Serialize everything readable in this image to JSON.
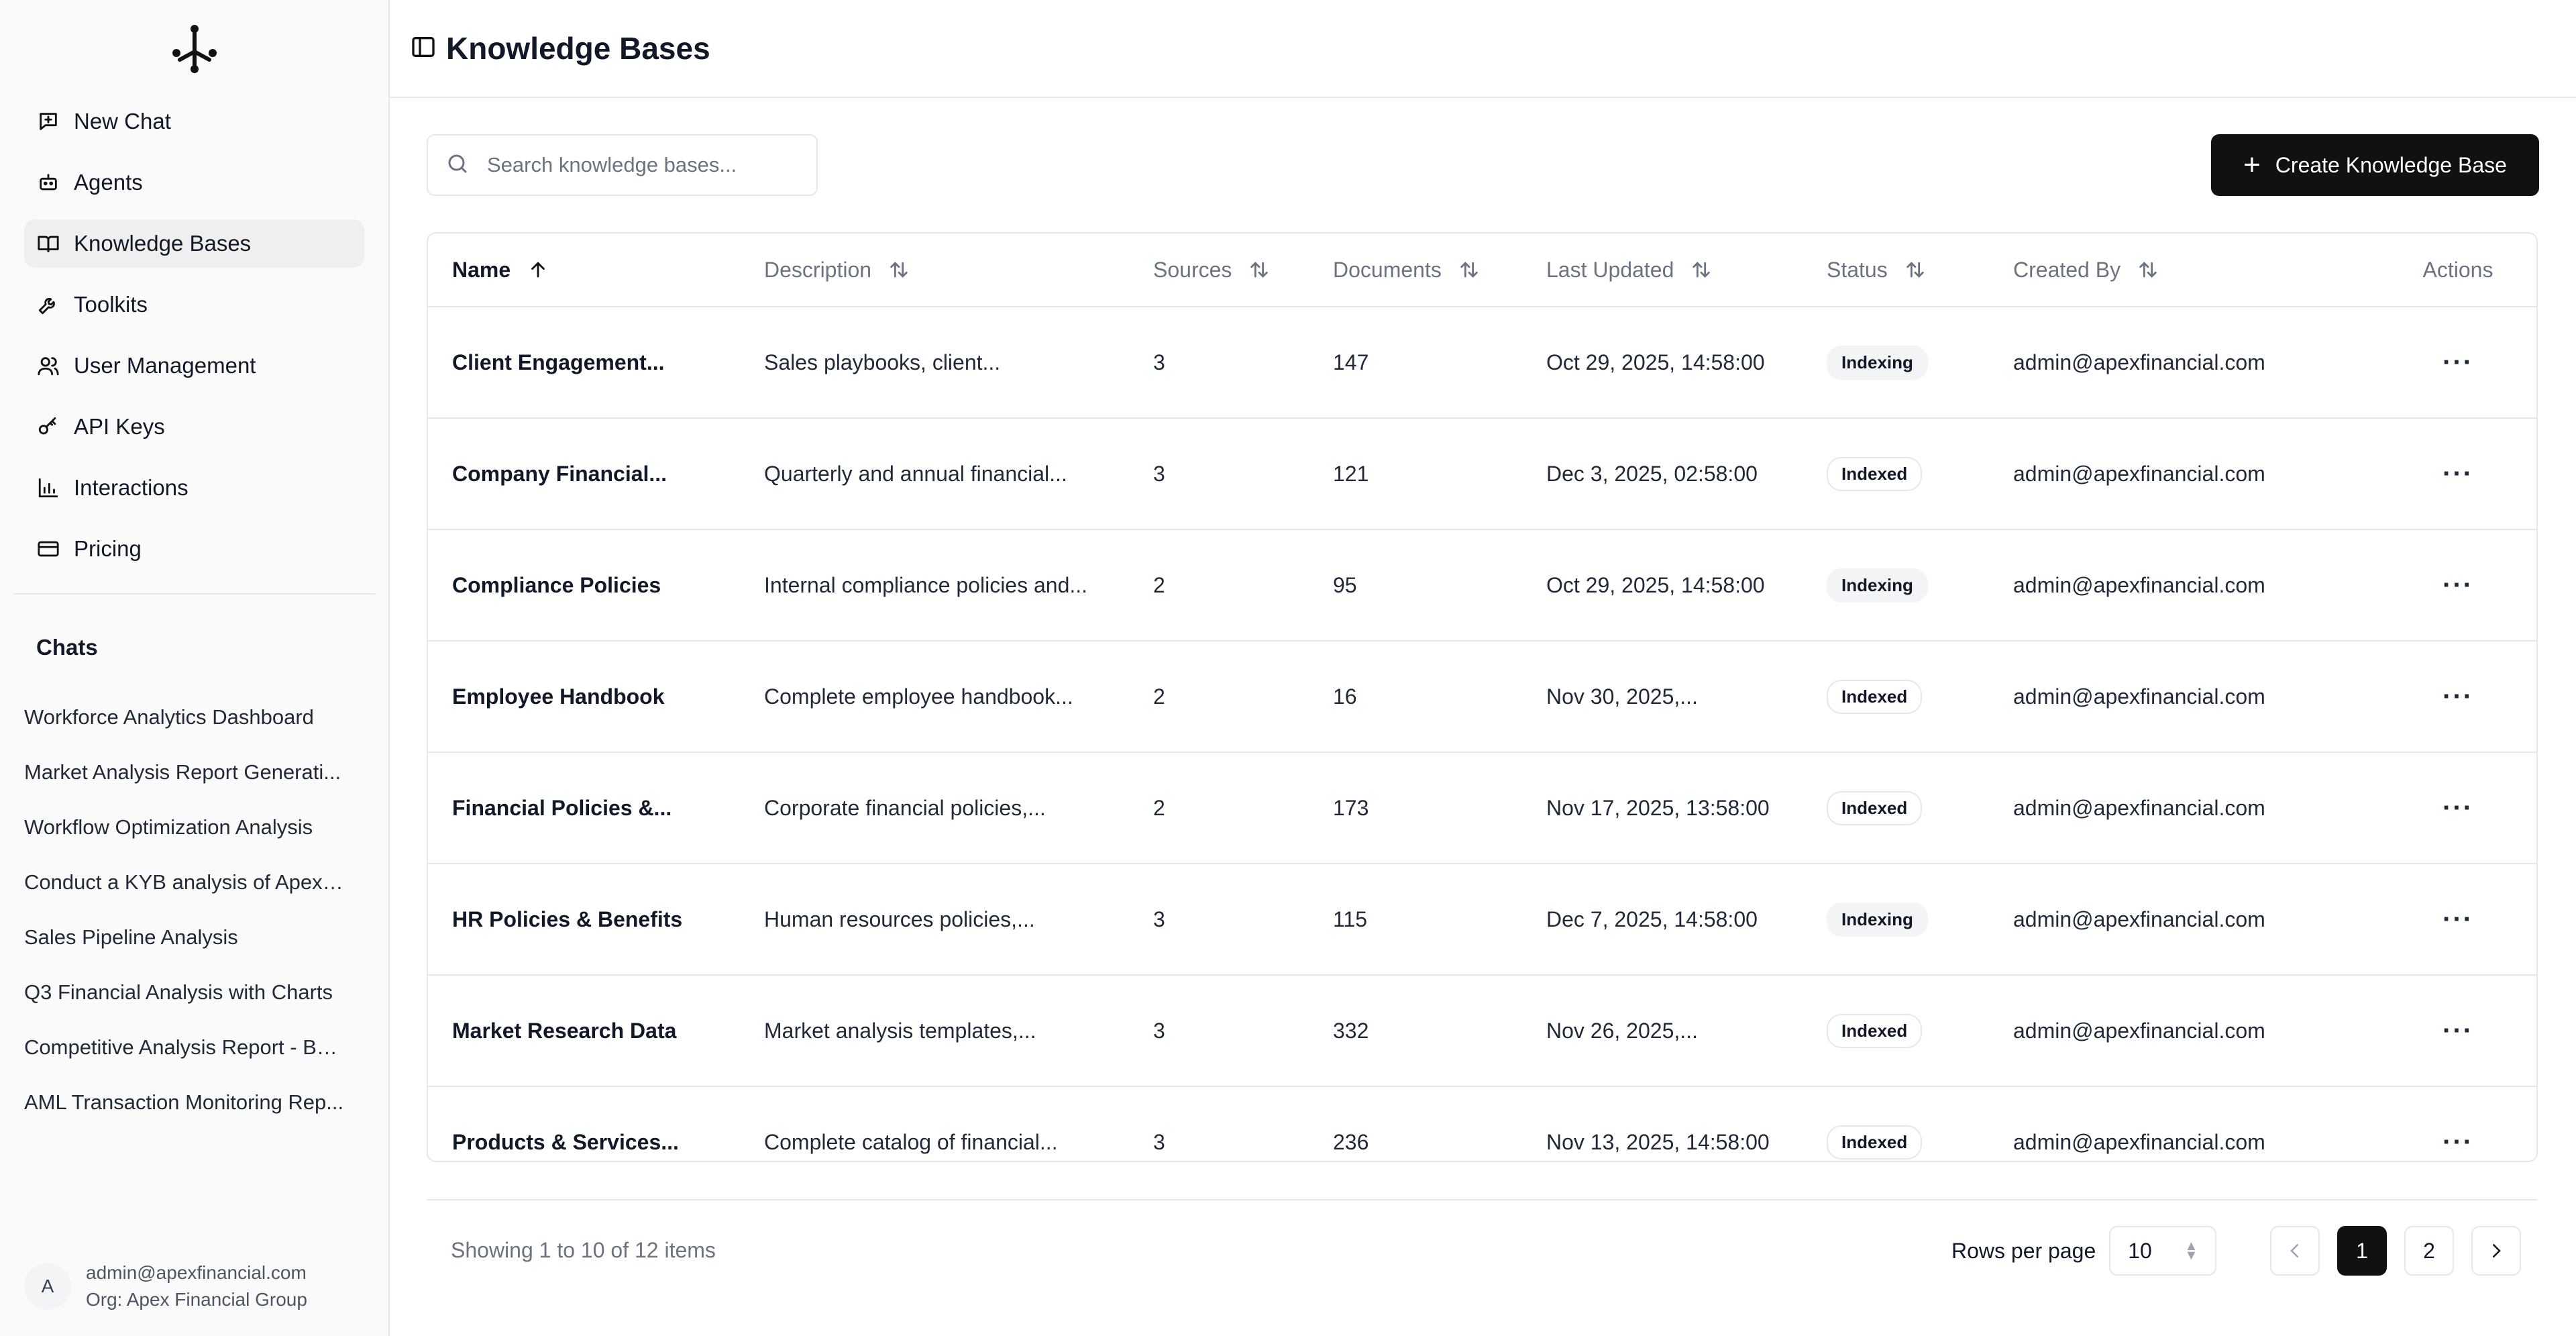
{
  "page": {
    "title": "Knowledge Bases"
  },
  "sidebar": {
    "nav": [
      {
        "label": "New Chat",
        "icon": "new-chat-icon"
      },
      {
        "label": "Agents",
        "icon": "robot-icon"
      },
      {
        "label": "Knowledge Bases",
        "icon": "book-icon",
        "active": true
      },
      {
        "label": "Toolkits",
        "icon": "wrench-icon"
      },
      {
        "label": "User Management",
        "icon": "users-icon"
      },
      {
        "label": "API Keys",
        "icon": "key-icon"
      },
      {
        "label": "Interactions",
        "icon": "bar-chart-icon"
      },
      {
        "label": "Pricing",
        "icon": "credit-card-icon"
      }
    ],
    "chats_title": "Chats",
    "chats": [
      "Workforce Analytics Dashboard",
      "Market Analysis Report Generati...",
      "Workflow Optimization Analysis",
      "Conduct a KYB analysis of Apex ...",
      "Sales Pipeline Analysis",
      "Q3 Financial Analysis with Charts",
      "Competitive Analysis Report - Ba...",
      "AML Transaction Monitoring Rep..."
    ],
    "user": {
      "initial": "A",
      "email": "admin@apexfinancial.com",
      "org": "Org: Apex Financial Group"
    }
  },
  "toolbar": {
    "search_placeholder": "Search knowledge bases...",
    "create_label": "Create Knowledge Base"
  },
  "table": {
    "columns": [
      "Name",
      "Description",
      "Sources",
      "Documents",
      "Last Updated",
      "Status",
      "Created By",
      "Actions"
    ],
    "rows": [
      {
        "name": "Client Engagement...",
        "description": "Sales playbooks, client...",
        "sources": "3",
        "documents": "147",
        "updated": "Oct 29, 2025, 14:58:00",
        "status": "Indexing",
        "created_by": "admin@apexfinancial.com"
      },
      {
        "name": "Company Financial...",
        "description": "Quarterly and annual financial...",
        "sources": "3",
        "documents": "121",
        "updated": "Dec 3, 2025, 02:58:00",
        "status": "Indexed",
        "created_by": "admin@apexfinancial.com"
      },
      {
        "name": "Compliance Policies",
        "description": "Internal compliance policies and...",
        "sources": "2",
        "documents": "95",
        "updated": "Oct 29, 2025, 14:58:00",
        "status": "Indexing",
        "created_by": "admin@apexfinancial.com"
      },
      {
        "name": "Employee Handbook",
        "description": "Complete employee handbook...",
        "sources": "2",
        "documents": "16",
        "updated": "Nov 30, 2025,...",
        "status": "Indexed",
        "created_by": "admin@apexfinancial.com"
      },
      {
        "name": "Financial Policies &...",
        "description": "Corporate financial policies,...",
        "sources": "2",
        "documents": "173",
        "updated": "Nov 17, 2025, 13:58:00",
        "status": "Indexed",
        "created_by": "admin@apexfinancial.com"
      },
      {
        "name": "HR Policies & Benefits",
        "description": "Human resources policies,...",
        "sources": "3",
        "documents": "115",
        "updated": "Dec 7, 2025, 14:58:00",
        "status": "Indexing",
        "created_by": "admin@apexfinancial.com"
      },
      {
        "name": "Market Research Data",
        "description": "Market analysis templates,...",
        "sources": "3",
        "documents": "332",
        "updated": "Nov 26, 2025,...",
        "status": "Indexed",
        "created_by": "admin@apexfinancial.com"
      },
      {
        "name": "Products & Services...",
        "description": "Complete catalog of financial...",
        "sources": "3",
        "documents": "236",
        "updated": "Nov 13, 2025, 14:58:00",
        "status": "Indexed",
        "created_by": "admin@apexfinancial.com"
      }
    ]
  },
  "footer": {
    "showing": "Showing 1 to 10 of 12 items",
    "rows_label": "Rows per page",
    "rows_value": "10",
    "pages": [
      "1",
      "2"
    ],
    "current_page": "1"
  }
}
